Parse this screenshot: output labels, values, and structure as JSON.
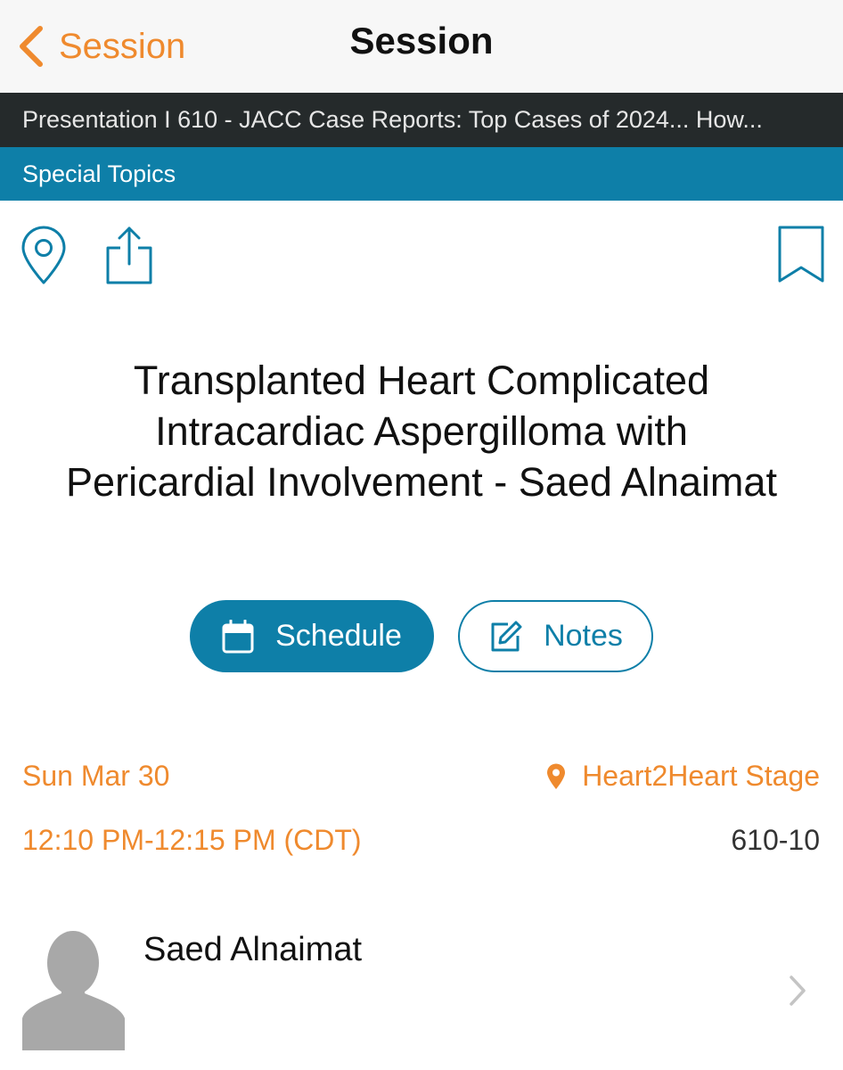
{
  "nav": {
    "back_label": "Session",
    "title": "Session"
  },
  "breadcrumb": {
    "text": "Presentation I 610 - JACC Case Reports: Top Cases of 2024... How..."
  },
  "topic": {
    "label": "Special Topics"
  },
  "toolbar": {
    "icons": [
      "map-pin-icon",
      "share-icon",
      "bookmark-icon"
    ]
  },
  "presentation": {
    "title_line1": "Transplanted Heart Complicated",
    "title_line2": "Intracardiac Aspergilloma with",
    "title_line3": "Pericardial Involvement - Saed Alnaimat"
  },
  "actions": {
    "schedule_label": "Schedule",
    "notes_label": "Notes"
  },
  "details": {
    "date": "Sun Mar 30",
    "location": "Heart2Heart Stage",
    "time": "12:10 PM-12:15 PM (CDT)",
    "code": "610-10"
  },
  "speaker": {
    "name": "Saed Alnaimat"
  },
  "colors": {
    "accent_orange": "#ef8a2e",
    "brand_blue": "#0e7fa8",
    "dark_bar": "#252a2b",
    "nav_background": "#f7f7f7"
  }
}
